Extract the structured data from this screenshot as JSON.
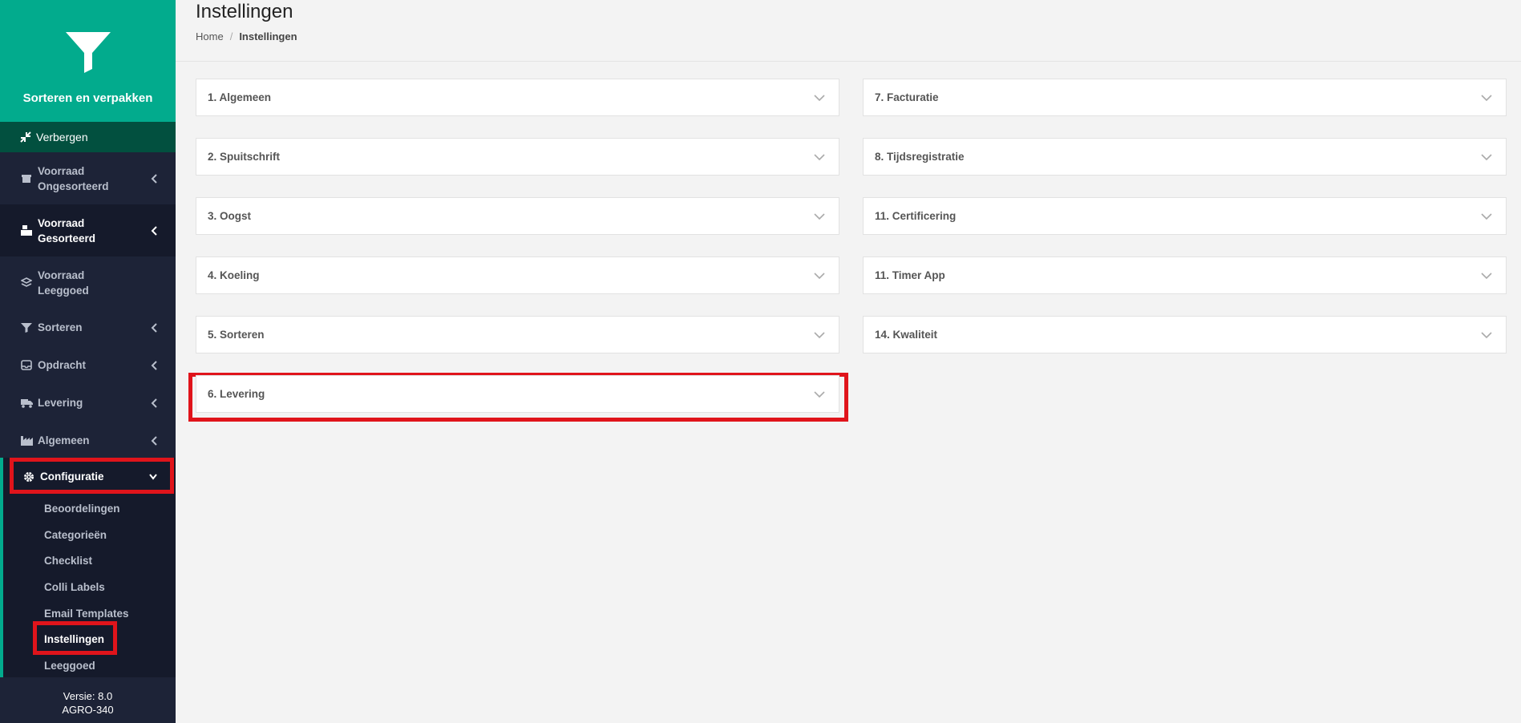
{
  "sidebar": {
    "brand_name": "Sorteren en verpakken",
    "hide_label": "Verbergen",
    "items": [
      {
        "label_line1": "Voorraad",
        "label_line2": "Ongesorteerd"
      },
      {
        "label_line1": "Voorraad",
        "label_line2": "Gesorteerd"
      },
      {
        "label_line1": "Voorraad",
        "label_line2": "Leeggoed"
      },
      {
        "label": "Sorteren"
      },
      {
        "label": "Opdracht"
      },
      {
        "label": "Levering"
      },
      {
        "label": "Algemeen"
      },
      {
        "label": "Configuratie"
      }
    ],
    "config_items": [
      "Beoordelingen",
      "Categorieën",
      "Checklist",
      "Colli Labels",
      "Email Templates",
      "Instellingen",
      "Leeggoed"
    ],
    "version_line1": "Versie: 8.0",
    "version_line2": "AGRO-340"
  },
  "header": {
    "title": "Instellingen",
    "breadcrumb_home": "Home",
    "breadcrumb_sep": "/",
    "breadcrumb_current": "Instellingen"
  },
  "panels_left": [
    "1. Algemeen",
    "2. Spuitschrift",
    "3. Oogst",
    "4. Koeling",
    "5. Sorteren",
    "6. Levering"
  ],
  "panels_right": [
    "7. Facturatie",
    "8. Tijdsregistratie",
    "11. Certificering",
    "11. Timer App",
    "14. Kwaliteit"
  ],
  "colors": {
    "brand": "#02ab8d",
    "sidebar": "#1d2337",
    "highlight": "#e0141b"
  }
}
